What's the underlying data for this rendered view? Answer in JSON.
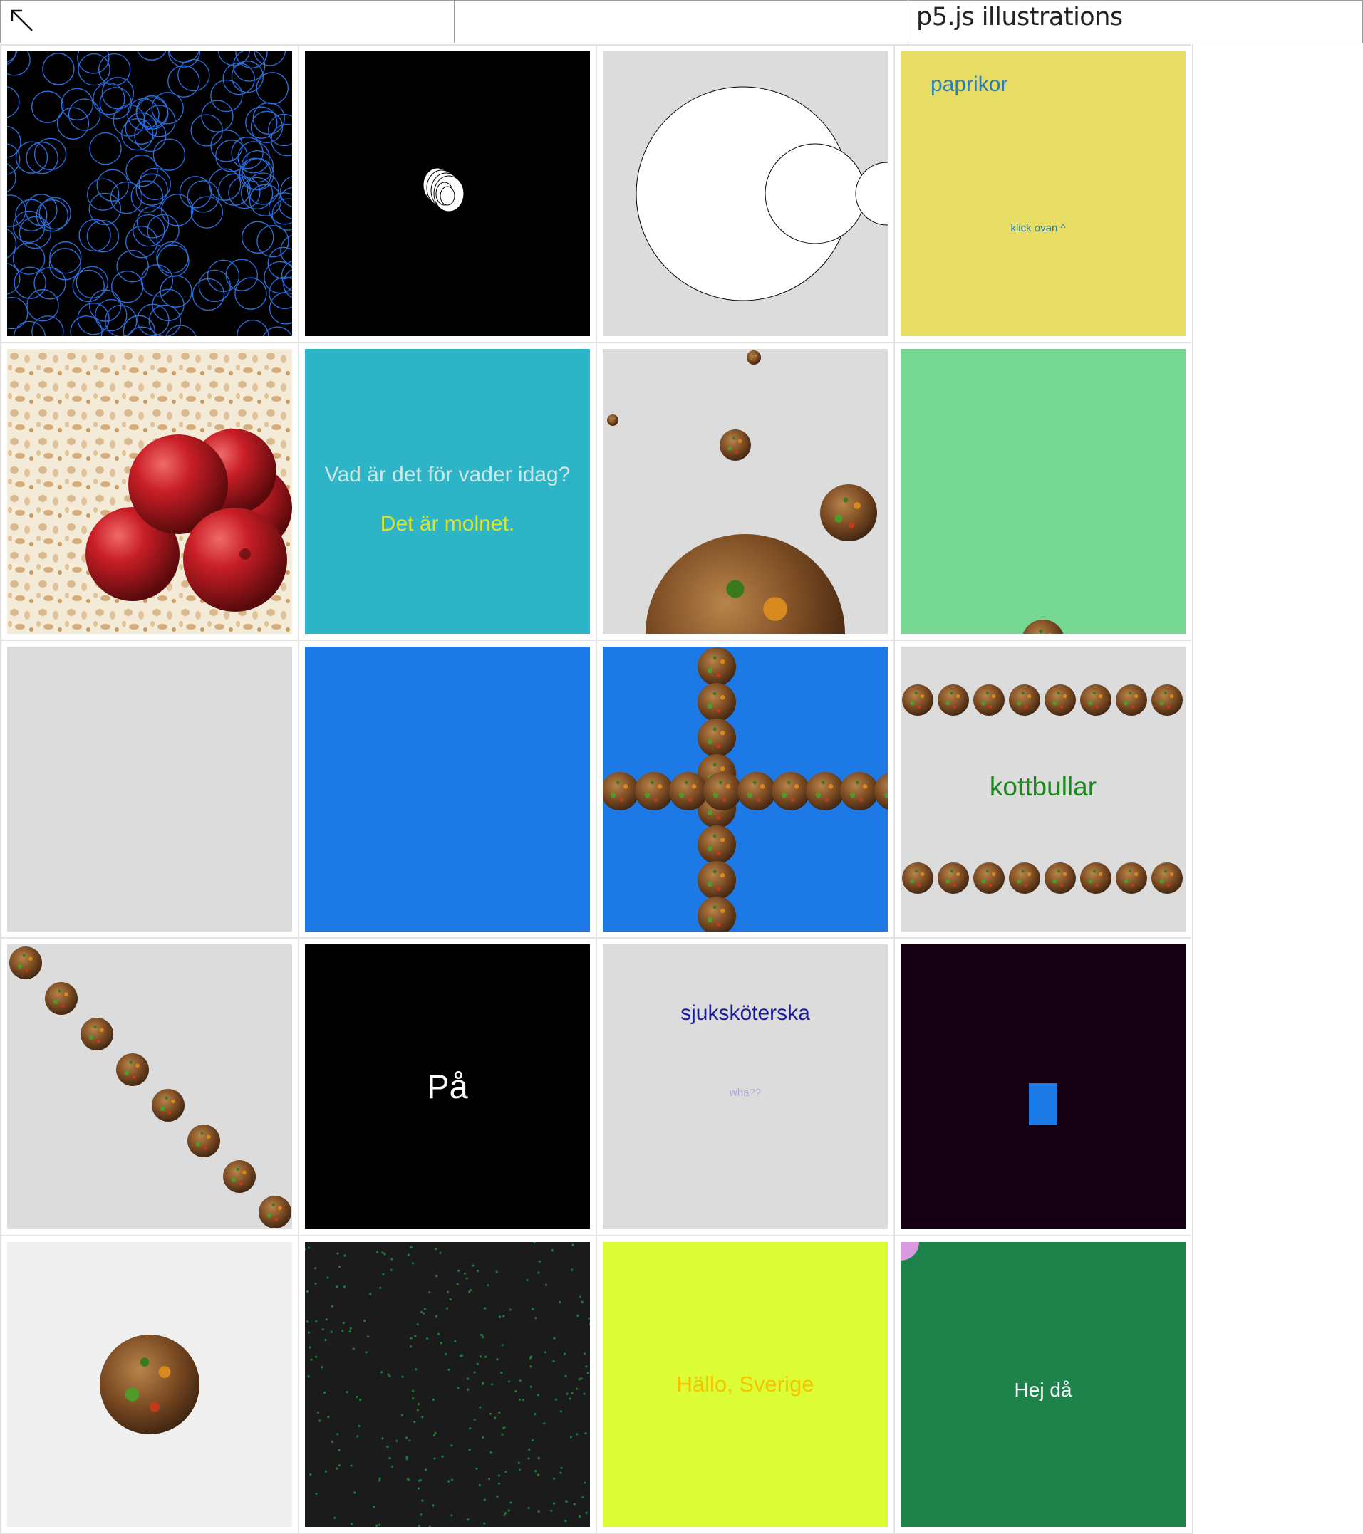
{
  "header": {
    "back_arrow": "↖",
    "middle_label": "",
    "title": "p5.js illustrations"
  },
  "sketches": {
    "circles": {
      "name": "blue circles",
      "bg": "#000000",
      "stroke": "#2a6fe0"
    },
    "ring": {
      "bg": "#000000"
    },
    "big_circles": {
      "bg": "#dcdcdc"
    },
    "paprikor": {
      "title": "paprikor",
      "hint": "klick ovan ^",
      "bg": "#e7dd64",
      "text_color": "#2a7fb5"
    },
    "lingon": {
      "bg": "#e8d6b8"
    },
    "weather": {
      "question": "Vad är det för vader idag?",
      "answer": "Det är molnet.",
      "bg": "#2db5c7"
    },
    "falling_meatballs": {
      "bg": "#dcdcdc"
    },
    "green_field": {
      "bg": "#76d892"
    },
    "blank_gray": {
      "bg": "#dcdcdc"
    },
    "blank_blue": {
      "bg": "#1c79e6"
    },
    "meatball_cross": {
      "bg": "#1c79e6"
    },
    "kottbullar": {
      "label": "kottbullar",
      "bg": "#dcdcdc",
      "text_color": "#1a8a1a"
    },
    "diagonal_meatballs": {
      "bg": "#dcdcdc"
    },
    "pa": {
      "label": "På",
      "bg": "#000000"
    },
    "nurse": {
      "label": "sjuksköterska",
      "sub": "wha??",
      "bg": "#dcdcdc"
    },
    "blue_rect": {
      "bg": "#140012",
      "rect_color": "#1c79e6"
    },
    "single_meatball": {
      "bg": "#efefef"
    },
    "green_dots": {
      "bg": "#1b1b1b",
      "dot_color": "#1f7a3a"
    },
    "hallo": {
      "label": "Hällo, Sverige",
      "bg": "#dcfd35",
      "text_color": "#f5c400"
    },
    "hej_da": {
      "label": "Hej då",
      "bg": "#1e834b",
      "accent": "#d899e0"
    }
  }
}
